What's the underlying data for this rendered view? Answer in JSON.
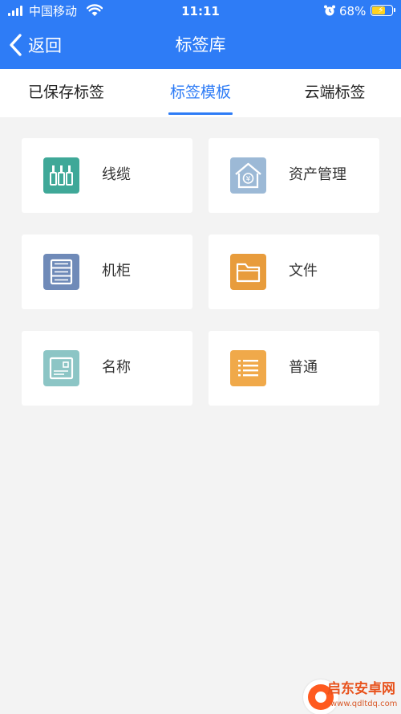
{
  "status_bar": {
    "carrier": "中国移动",
    "time": "11:11",
    "battery_percent": "68%",
    "battery_level": 0.68
  },
  "nav": {
    "back_label": "返回",
    "title": "标签库"
  },
  "tabs": [
    {
      "label": "已保存标签",
      "active": false
    },
    {
      "label": "标签模板",
      "active": true
    },
    {
      "label": "云端标签",
      "active": false
    }
  ],
  "templates": [
    {
      "label": "线缆",
      "icon": "cable-icon",
      "color": "#3fa898"
    },
    {
      "label": "资产管理",
      "icon": "asset-house-icon",
      "color": "#9cb9d6"
    },
    {
      "label": "机柜",
      "icon": "cabinet-icon",
      "color": "#6f8ab8"
    },
    {
      "label": "文件",
      "icon": "folder-icon",
      "color": "#e89c3c"
    },
    {
      "label": "名称",
      "icon": "name-card-icon",
      "color": "#8cc5c5"
    },
    {
      "label": "普通",
      "icon": "list-icon",
      "color": "#f0a94a"
    }
  ],
  "watermark": {
    "name": "启东安卓网",
    "url": "www.qdltdq.com"
  },
  "colors": {
    "brand": "#2e7cf6",
    "background": "#f3f3f3"
  }
}
